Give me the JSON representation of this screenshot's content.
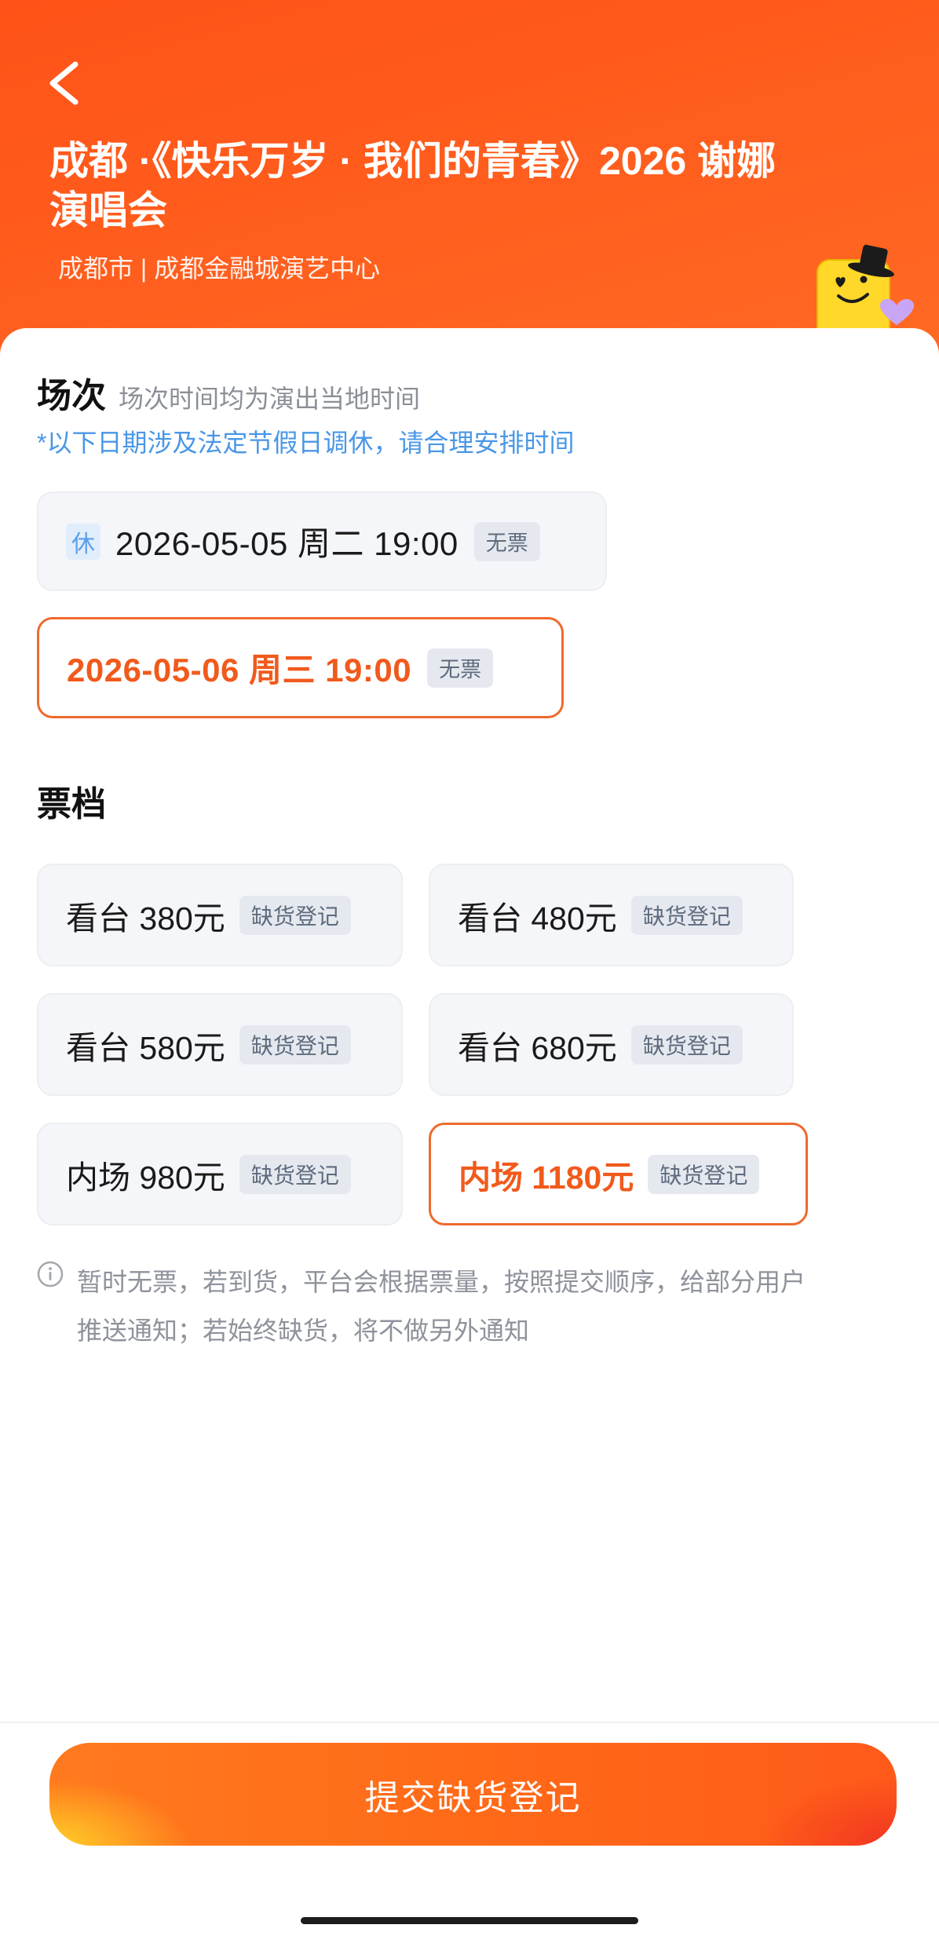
{
  "header": {
    "back_icon": "chevron-left-icon",
    "title_lines": [
      "成都 ·《快乐万岁 · 我们的青春》2026 谢娜",
      "演唱会"
    ],
    "venue": "成都市 | 成都金融城演艺中心",
    "mascot_icon": "mascot-sticker-icon"
  },
  "sessions": {
    "heading": "场次",
    "timezone_note": "场次时间均为演出当地时间",
    "holiday_note": "*以下日期涉及法定节假日调休，请合理安排时间",
    "items": [
      {
        "holiday_badge": "休",
        "datetime": "2026-05-05 周二 19:00",
        "status": "无票",
        "selected": false
      },
      {
        "datetime": "2026-05-06 周三 19:00",
        "status": "无票",
        "selected": true
      }
    ]
  },
  "tiers": {
    "heading": "票档",
    "items": [
      {
        "label": "看台 380元",
        "status": "缺货登记",
        "selected": false
      },
      {
        "label": "看台 480元",
        "status": "缺货登记",
        "selected": false
      },
      {
        "label": "看台 580元",
        "status": "缺货登记",
        "selected": false
      },
      {
        "label": "看台 680元",
        "status": "缺货登记",
        "selected": false
      },
      {
        "label": "内场 980元",
        "status": "缺货登记",
        "selected": false
      },
      {
        "label": "内场 1180元",
        "status": "缺货登记",
        "selected": true
      }
    ]
  },
  "notice": {
    "icon": "info-circle-icon",
    "lines": [
      "暂时无票，若到货，平台会根据票量，按照提交顺序，给部分用户",
      "推送通知；若始终缺货，将不做另外通知"
    ]
  },
  "footer": {
    "submit_label": "提交缺货登记"
  },
  "colors": {
    "header_orange": "#ff5a1c",
    "accent": "#f05a1c",
    "holiday_blue": "#4a97e6",
    "badge_gray": "#e5e9ef"
  }
}
